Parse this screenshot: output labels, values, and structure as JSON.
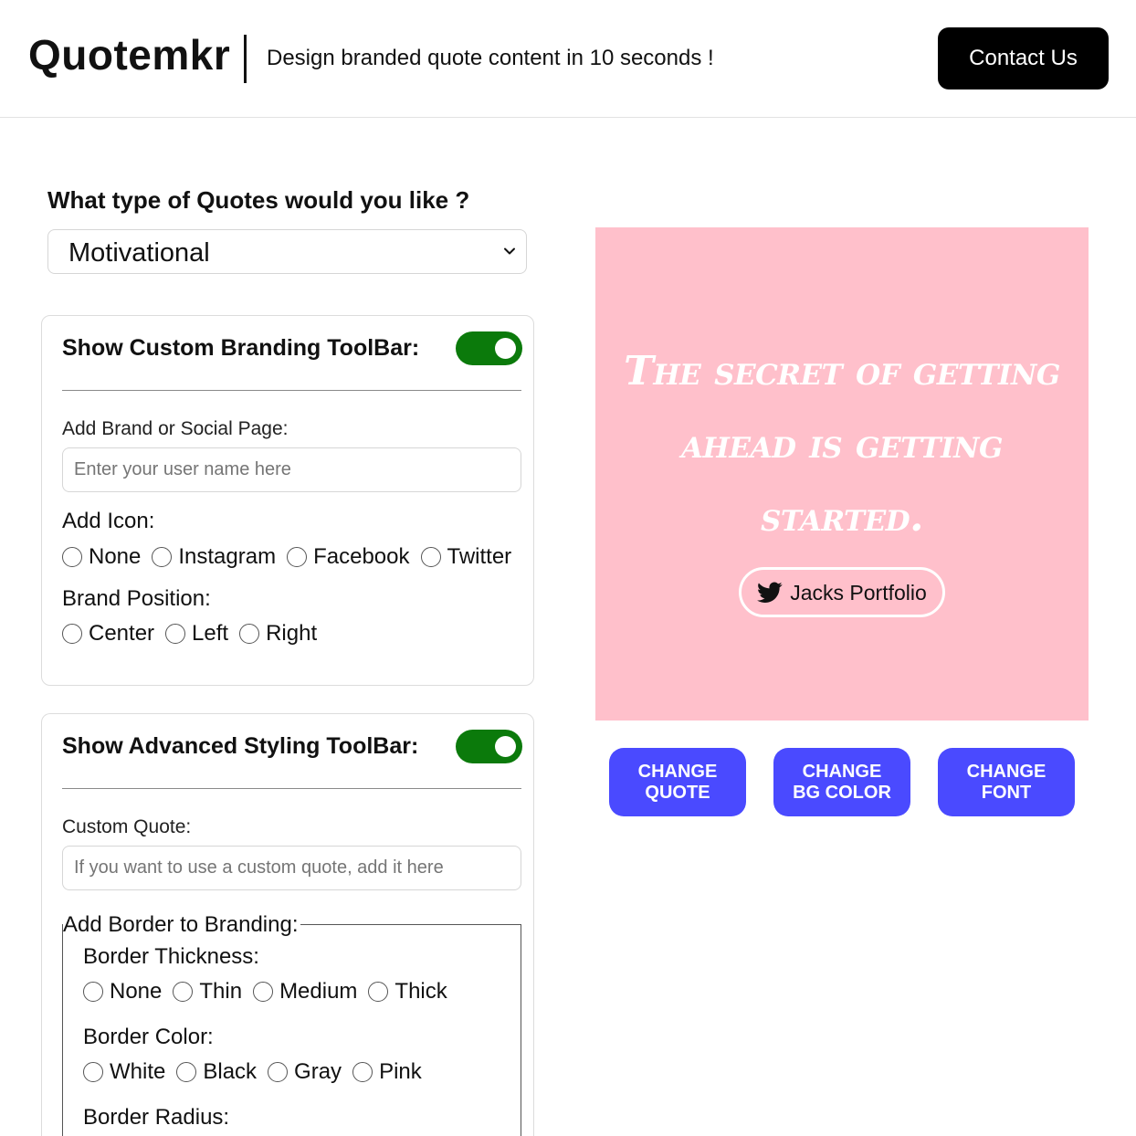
{
  "header": {
    "logo": "Quotemkr",
    "tagline": "Design branded quote content in 10 seconds !",
    "contact_label": "Contact Us"
  },
  "quote_type": {
    "question": "What type of Quotes would you like ?",
    "selected": "Motivational"
  },
  "branding_toolbar": {
    "title": "Show Custom Branding ToolBar:",
    "enabled": true,
    "brand_label": "Add Brand or Social Page:",
    "brand_placeholder": "Enter your user name here",
    "icon_label": "Add Icon:",
    "icon_options": [
      "None",
      "Instagram",
      "Facebook",
      "Twitter"
    ],
    "position_label": "Brand Position:",
    "position_options": [
      "Center",
      "Left",
      "Right"
    ]
  },
  "styling_toolbar": {
    "title": "Show Advanced Styling ToolBar:",
    "enabled": true,
    "custom_quote_label": "Custom Quote:",
    "custom_quote_placeholder": "If you want to use a custom quote, add it here",
    "border_legend": "Add Border to Branding:",
    "thickness_label": "Border Thickness:",
    "thickness_options": [
      "None",
      "Thin",
      "Medium",
      "Thick"
    ],
    "color_label": "Border Color:",
    "color_options": [
      "White",
      "Black",
      "Gray",
      "Pink"
    ],
    "radius_label": "Border Radius:"
  },
  "preview": {
    "quote": "The secret of getting ahead is getting started.",
    "brand_icon": "twitter-icon",
    "brand_name": "Jacks Portfolio",
    "background_color": "#ffc0cb"
  },
  "actions": {
    "change_quote": "CHANGE\nQUOTE",
    "change_bg": "CHANGE\nBG COLOR",
    "change_font": "CHANGE\nFONT"
  },
  "colors": {
    "toggle_on": "#0b7a0b",
    "action_button": "#4a4aff",
    "contact_button": "#000000"
  }
}
